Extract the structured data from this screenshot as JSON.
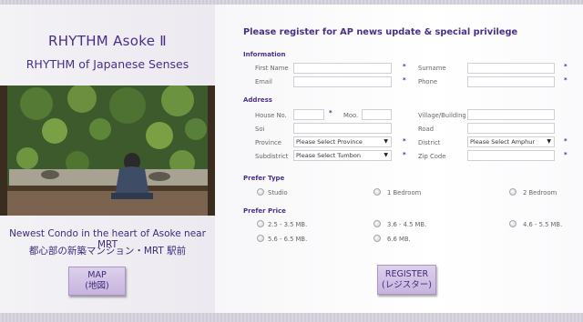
{
  "brand": {
    "name": "RHYTHM Asoke Ⅱ",
    "tagline": "RHYTHM of Japanese Senses",
    "headline": "Newest Condo in the heart of Asoke near MRT",
    "headline_jp": "都心部の新築マンション・MRT 駅前",
    "map_button": {
      "line1": "MAP",
      "line2": "(地図)"
    }
  },
  "form": {
    "title": "Please register for AP news update & special privilege",
    "required_mark": "*",
    "sections": {
      "information": "Information",
      "address": "Address",
      "prefer_type": "Prefer Type",
      "prefer_price": "Prefer Price"
    },
    "fields": {
      "first_name": "First Name",
      "surname": "Surname",
      "email": "Email",
      "phone": "Phone",
      "house_no": "House No.",
      "moo": "Moo.",
      "village": "Village/Building",
      "soi": "Soi",
      "road": "Road",
      "province": "Province",
      "district": "District",
      "subdistrict": "Subdistrict",
      "zip": "Zip Code"
    },
    "selects": {
      "province": "Please Select Province",
      "district": "Please Select Amphur",
      "subdistrict": "Please Select Tumbon"
    },
    "types": [
      "Studio",
      "1 Bedroom",
      "2 Bedroom"
    ],
    "prices": [
      "2.5 - 3.5 MB.",
      "3.6 - 4.5 MB.",
      "4.6 - 5.5 MB.",
      "5.6 - 6.5 MB.",
      "6.6 MB."
    ],
    "register_button": {
      "line1": "REGISTER",
      "line2": "(レジスター)"
    }
  },
  "colors": {
    "accent": "#4a2f86",
    "button": "#d3c3e6"
  }
}
